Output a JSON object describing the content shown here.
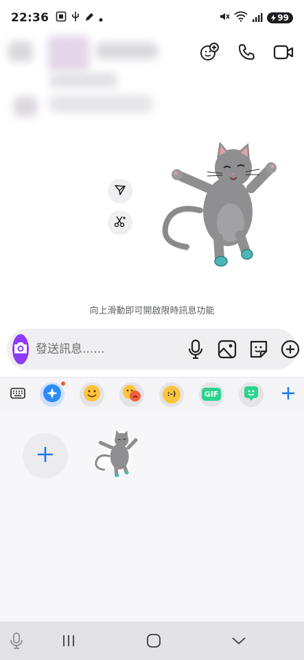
{
  "status_bar": {
    "time": "22:36",
    "left_icons": [
      "screenshot-icon",
      "usb-icon",
      "pen-icon",
      "dot-icon"
    ],
    "right_icons": [
      "mute-vibrate-icon",
      "wifi-icon",
      "signal-icon"
    ],
    "battery": "99"
  },
  "header": {
    "actions": [
      "add-participant-icon",
      "voice-call-icon",
      "video-call-icon"
    ]
  },
  "chat": {
    "side_actions": [
      "forward-icon",
      "cutout-icon"
    ],
    "vanish_hint": "向上滑動即可開啟限時訊息功能"
  },
  "composer": {
    "placeholder": "發送訊息......",
    "icons": [
      "microphone-icon",
      "gallery-icon",
      "sticker-icon",
      "plus-circle-icon"
    ]
  },
  "tray": {
    "tabs": [
      "keyboard-icon",
      "ai-sparkle-icon",
      "smiley-icon",
      "mixed-emoji-icon",
      "text-emoticon-icon",
      "gif-icon",
      "avatar-sticker-icon"
    ],
    "emoticon_text": ":-)",
    "gif_label": "GIF"
  },
  "nav": {
    "items": [
      "microphone-icon",
      "recent-apps-icon",
      "home-icon",
      "back-icon"
    ]
  },
  "colors": {
    "accent": "#1877f2",
    "camera": "#8e3cf7",
    "badge": "#f0552b",
    "gif": "#2bd38f"
  }
}
